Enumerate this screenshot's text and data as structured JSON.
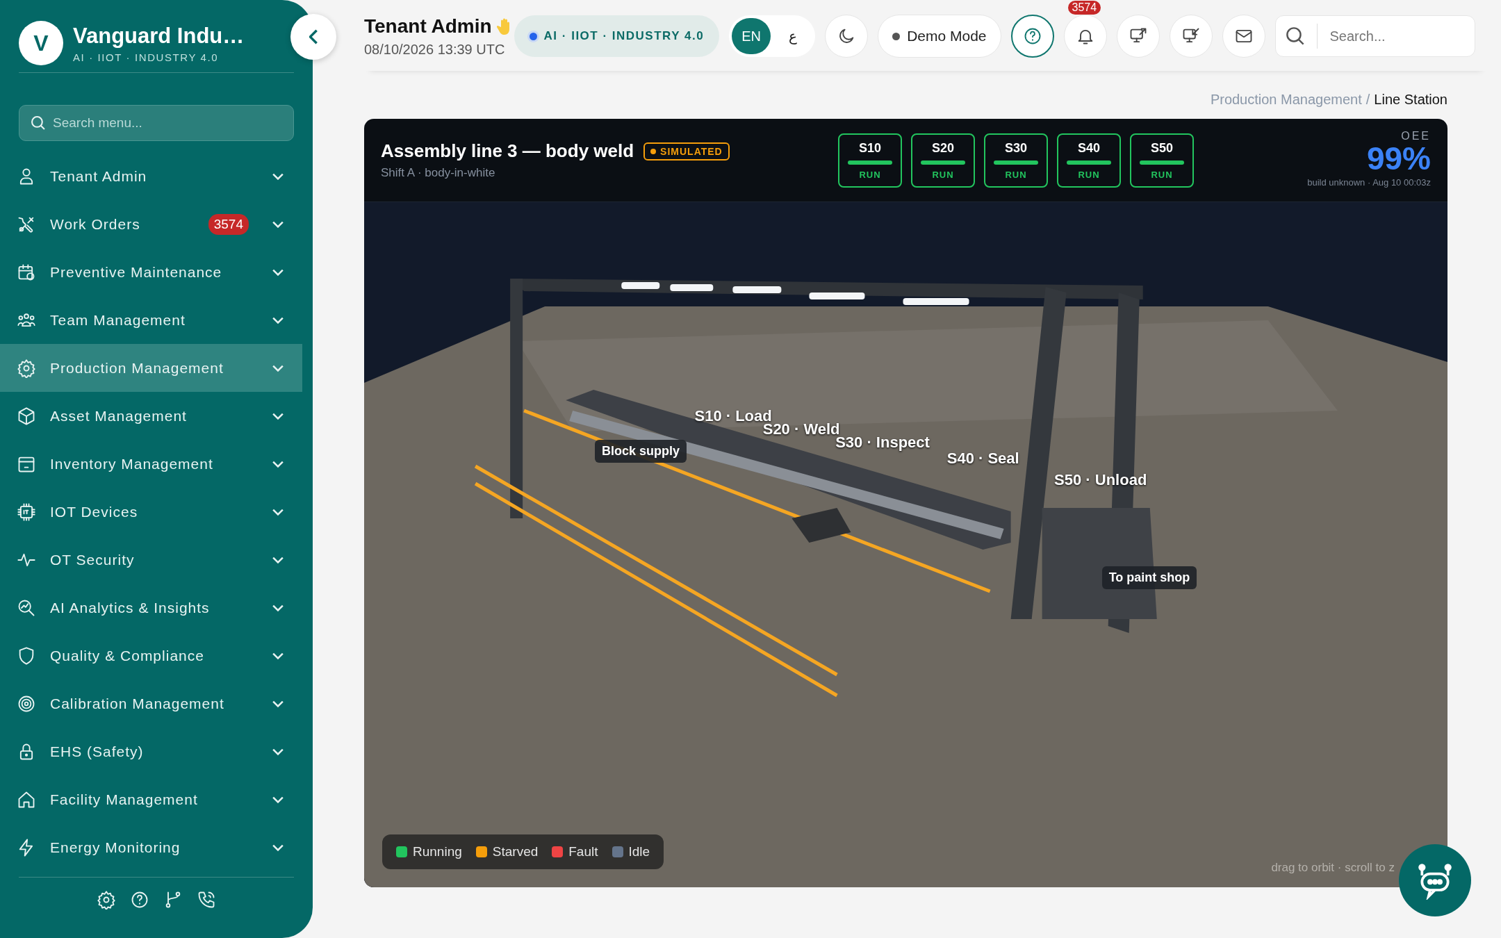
{
  "sidebar": {
    "logo_letter": "V",
    "brand": "Vanguard Indu…",
    "tagline": "AI · IIOT · INDUSTRY 4.0",
    "search": {
      "placeholder": "Search menu..."
    },
    "items": [
      {
        "label": "Tenant Admin",
        "selected": false
      },
      {
        "label": "Work Orders",
        "badge": "3574",
        "selected": false
      },
      {
        "label": "Preventive Maintenance",
        "selected": false
      },
      {
        "label": "Team Management",
        "selected": false
      },
      {
        "label": "Production Management",
        "selected": true
      },
      {
        "label": "Asset Management",
        "selected": false
      },
      {
        "label": "Inventory Management",
        "selected": false
      },
      {
        "label": "IOT Devices",
        "selected": false
      },
      {
        "label": "OT Security",
        "selected": false
      },
      {
        "label": "AI Analytics & Insights",
        "selected": false
      },
      {
        "label": "Quality & Compliance",
        "selected": false
      },
      {
        "label": "Calibration Management",
        "selected": false
      },
      {
        "label": "EHS (Safety)",
        "selected": false
      },
      {
        "label": "Facility Management",
        "selected": false
      },
      {
        "label": "Energy Monitoring",
        "selected": false
      }
    ]
  },
  "topbar": {
    "title": "Tenant Admin",
    "datetime": "08/10/2026 13:39 UTC",
    "tags": "AI · IIOT · INDUSTRY 4.0",
    "languages": [
      {
        "label": "EN",
        "selected": true
      },
      {
        "label": "ع",
        "selected": false
      }
    ],
    "demo_mode": "Demo Mode",
    "notifications_badge": "3574",
    "search": {
      "placeholder": "Search..."
    }
  },
  "breadcrumb": {
    "items": [
      "Production Management",
      "Line Station"
    ],
    "separator": "/"
  },
  "viewer": {
    "title": "Assembly line 3 — body weld",
    "badge": "SIMULATED",
    "subtitle": "Shift A · body-in-white",
    "stations": [
      {
        "id": "S10",
        "status": "RUN"
      },
      {
        "id": "S20",
        "status": "RUN"
      },
      {
        "id": "S30",
        "status": "RUN"
      },
      {
        "id": "S40",
        "status": "RUN"
      },
      {
        "id": "S50",
        "status": "RUN"
      }
    ],
    "oee_label": "OEE",
    "oee_value": "99%",
    "build": "build unknown · Aug 10 00:03z",
    "scene_labels": [
      {
        "text": "S10 · Load",
        "kind": "station"
      },
      {
        "text": "S20 · Weld",
        "kind": "station"
      },
      {
        "text": "S30 · Inspect",
        "kind": "station"
      },
      {
        "text": "S40 · Seal",
        "kind": "station"
      },
      {
        "text": "S50 · Unload",
        "kind": "station"
      },
      {
        "text": "Block supply",
        "kind": "tag"
      },
      {
        "text": "To paint shop",
        "kind": "tag"
      }
    ],
    "legend": [
      {
        "label": "Running",
        "color": "#22c55e"
      },
      {
        "label": "Starved",
        "color": "#f59e0b"
      },
      {
        "label": "Fault",
        "color": "#ef4444"
      },
      {
        "label": "Idle",
        "color": "#64748b"
      }
    ],
    "hint": "drag to orbit · scroll to z"
  }
}
